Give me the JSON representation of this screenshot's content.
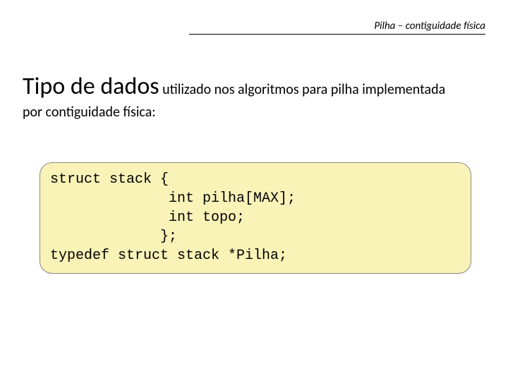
{
  "header": {
    "title": "Pilha – contiguidade física"
  },
  "body": {
    "emphasis": "Tipo de dados",
    "rest_line1": " utilizado nos algoritmos para pilha implementada",
    "line2": "por contiguidade física:"
  },
  "code": {
    "line1": "struct stack {",
    "line2": "              int pilha[MAX];",
    "line3": "              int topo;",
    "line4": "             };",
    "line5": "typedef struct stack *Pilha;"
  }
}
